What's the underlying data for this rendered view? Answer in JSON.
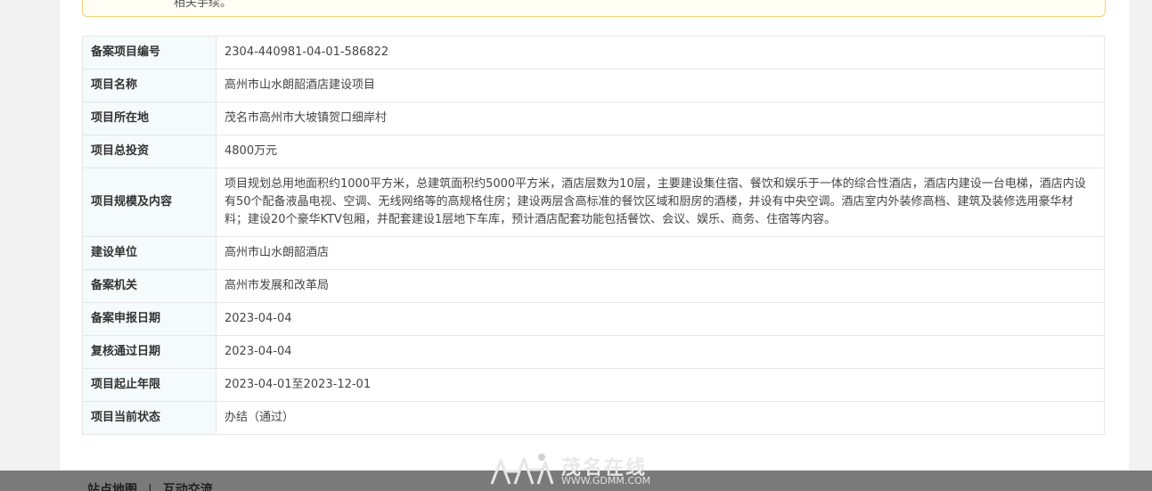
{
  "notice": {
    "text": "相关手续。"
  },
  "rows": [
    {
      "key": "备案项目编号",
      "value": "2304-440981-04-01-586822"
    },
    {
      "key": "项目名称",
      "value": "高州市山水朗韶酒店建设项目"
    },
    {
      "key": "项目所在地",
      "value": "茂名市高州市大坡镇贺口细岸村"
    },
    {
      "key": "项目总投资",
      "value": "4800万元"
    },
    {
      "key": "项目规模及内容",
      "value": "项目规划总用地面积约1000平方米，总建筑面积约5000平方米，酒店层数为10层，主要建设集住宿、餐饮和娱乐于一体的综合性酒店，酒店内建设一台电梯，酒店内设有50个配备液晶电视、空调、无线网络等的高规格住房；建设两层含高标准的餐饮区域和厨房的酒楼，并设有中央空调。酒店室内外装修高档、建筑及装修选用豪华材料；建设20个豪华KTV包厢，并配套建设1层地下车库，预计酒店配套功能包括餐饮、会议、娱乐、商务、住宿等内容。"
    },
    {
      "key": "建设单位",
      "value": "高州市山水朗韶酒店"
    },
    {
      "key": "备案机关",
      "value": "高州市发展和改革局"
    },
    {
      "key": "备案申报日期",
      "value": "2023-04-04"
    },
    {
      "key": "复核通过日期",
      "value": "2023-04-04"
    },
    {
      "key": "项目起止年限",
      "value": "2023-04-01至2023-12-01"
    },
    {
      "key": "项目当前状态",
      "value": "办结（通过）"
    }
  ],
  "footer": {
    "links": [
      "站点地图",
      "互动交流"
    ],
    "separator": "|"
  },
  "logo": {
    "name": "茂名在线",
    "url": "WWW.GDMM.COM"
  }
}
